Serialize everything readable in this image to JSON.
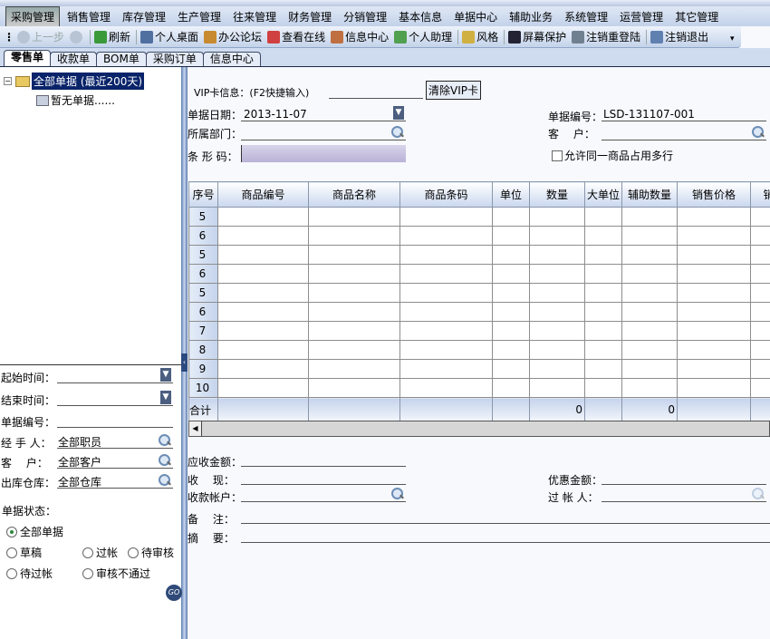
{
  "menu": [
    "采购管理",
    "销售管理",
    "库存管理",
    "生产管理",
    "往来管理",
    "财务管理",
    "分销管理",
    "基本信息",
    "单据中心",
    "辅助业务",
    "系统管理",
    "运营管理",
    "其它管理"
  ],
  "toolbar": [
    {
      "label": "上一步",
      "icon": "back-icon",
      "color": "#b8c4d4",
      "disabled": true
    },
    {
      "label": "",
      "icon": "forward-icon",
      "color": "#b8c4d4",
      "disabled": true
    },
    {
      "label": "刷新",
      "icon": "refresh-icon",
      "color": "#3a9a3a"
    },
    {
      "label": "个人桌面",
      "icon": "desktop-icon",
      "color": "#5070a0"
    },
    {
      "label": "办公论坛",
      "icon": "home-icon",
      "color": "#c88a30"
    },
    {
      "label": "查看在线",
      "icon": "calendar-icon",
      "color": "#d04040"
    },
    {
      "label": "信息中心",
      "icon": "info-center-icon",
      "color": "#c07040"
    },
    {
      "label": "个人助理",
      "icon": "assistant-icon",
      "color": "#50a050"
    },
    {
      "label": "风格",
      "icon": "style-icon",
      "color": "#d0b040"
    },
    {
      "label": "屏幕保护",
      "icon": "monitor-icon",
      "color": "#223"
    },
    {
      "label": "注销重登陆",
      "icon": "relogin-icon",
      "color": "#708090"
    },
    {
      "label": "注销退出",
      "icon": "exit-icon",
      "color": "#6080b0"
    }
  ],
  "tabs": [
    "零售单",
    "收款单",
    "BOM单",
    "采购订单",
    "信息中心"
  ],
  "tree": {
    "root": "全部单据 (最近200天)",
    "child": "暂无单据......"
  },
  "filters": {
    "start_time": "起始时间：",
    "end_time": "结束时间：",
    "bill_no": "单据编号：",
    "handler": "经 手 人：",
    "handler_value": "全部职员",
    "customer": "客　 户：",
    "customer_value": "全部客户",
    "warehouse": "出库仓库：",
    "warehouse_value": "全部仓库",
    "status_label": "单据状态：",
    "status_options": [
      "全部单据",
      "草稿",
      "过帐",
      "待审核",
      "待过帐",
      "审核不通过"
    ],
    "go": "GO"
  },
  "form": {
    "vip_label": "VIP卡信息：(F2快捷输入)",
    "clear_vip": "清除VIP卡",
    "date_label": "单据日期：",
    "date_value": "2013-11-07",
    "bill_no_label": "单据编号：",
    "bill_no_value": "LSD-131107-001",
    "dept_label": "所属部门：",
    "customer_label": "客　 户：",
    "barcode_label": "条 形 码：",
    "allow_multi": "允许同一商品占用多行"
  },
  "grid": {
    "columns": [
      "序号",
      "商品编号",
      "商品名称",
      "商品条码",
      "单位",
      "数量",
      "大单位",
      "辅助数量",
      "销售价格",
      "销"
    ],
    "row_numbers": [
      "5",
      "6",
      "5",
      "6",
      "5",
      "6",
      "7",
      "8",
      "9",
      "10"
    ],
    "total_label": "合计",
    "total_qty": "0",
    "total_aux_qty": "0"
  },
  "footer": {
    "receivable": "应收金额：",
    "cash": "收　 现：",
    "account": "收款帐户：",
    "discount": "优惠金额：",
    "poster": "过 帐 人：",
    "remark": "备　 注：",
    "summary": "摘　 要："
  }
}
